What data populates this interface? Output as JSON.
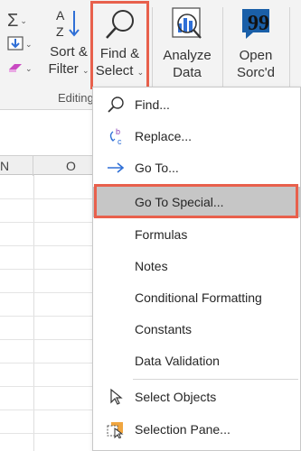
{
  "ribbon": {
    "autosum_icon": "sigma-icon",
    "fill_icon": "fill-down-icon",
    "clear_icon": "eraser-icon",
    "sort_filter": {
      "line1": "Sort &",
      "line2": "Filter"
    },
    "find_select": {
      "line1": "Find &",
      "line2": "Select"
    },
    "analyze_data": {
      "line1": "Analyze",
      "line2": "Data"
    },
    "open_sorcd": {
      "line1": "Open",
      "line2": "Sorc'd"
    },
    "group_label": "Editing"
  },
  "sheet": {
    "column_headers": [
      "N",
      "O"
    ]
  },
  "menu": {
    "items": [
      {
        "label": "Find...",
        "icon": "search-icon"
      },
      {
        "label": "Replace...",
        "icon": "replace-icon"
      },
      {
        "label": "Go To...",
        "icon": "arrow-right-icon"
      },
      {
        "label": "Go To Special...",
        "icon": ""
      },
      {
        "label": "Formulas",
        "icon": ""
      },
      {
        "label": "Notes",
        "icon": ""
      },
      {
        "label": "Conditional Formatting",
        "icon": ""
      },
      {
        "label": "Constants",
        "icon": ""
      },
      {
        "label": "Data Validation",
        "icon": ""
      },
      {
        "label": "Select Objects",
        "icon": "cursor-arrow-icon"
      },
      {
        "label": "Selection Pane...",
        "icon": "selection-pane-icon"
      }
    ]
  },
  "colors": {
    "highlight": "#e8604c",
    "selected_item": "#c6c6c6",
    "accent_blue": "#2f6fd6"
  }
}
